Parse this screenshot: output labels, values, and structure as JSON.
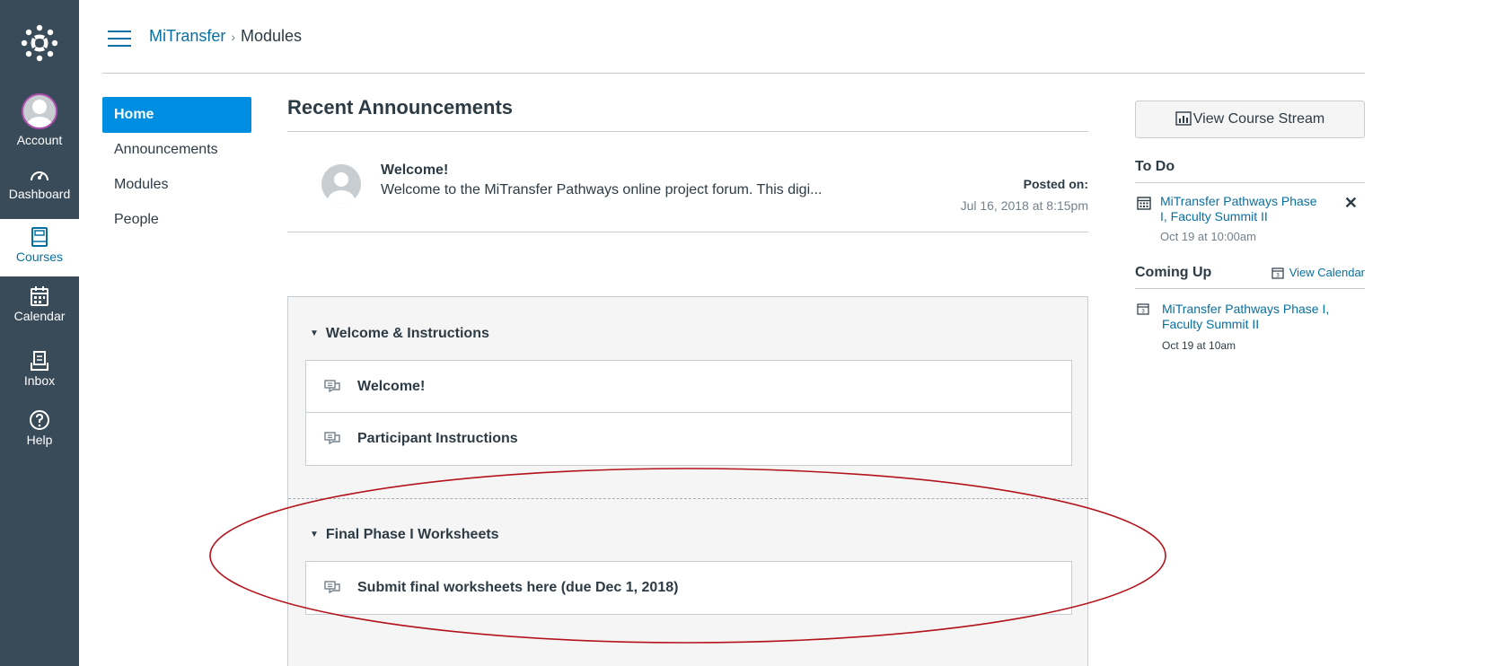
{
  "global_nav": {
    "items": [
      {
        "label": "Account",
        "icon": "user-avatar"
      },
      {
        "label": "Dashboard",
        "icon": "speedometer-icon"
      },
      {
        "label": "Courses",
        "icon": "book-icon",
        "active": true
      },
      {
        "label": "Calendar",
        "icon": "calendar-icon"
      },
      {
        "label": "Inbox",
        "icon": "inbox-icon"
      },
      {
        "label": "Help",
        "icon": "help-icon"
      }
    ]
  },
  "breadcrumb": {
    "course": "MiTransfer",
    "separator": "›",
    "page": "Modules"
  },
  "course_nav": {
    "items": [
      {
        "label": "Home",
        "active": true
      },
      {
        "label": "Announcements"
      },
      {
        "label": "Modules"
      },
      {
        "label": "People"
      }
    ]
  },
  "announcements": {
    "title": "Recent Announcements",
    "items": [
      {
        "title": "Welcome!",
        "preview": "Welcome to the MiTransfer Pathways online project forum. This digi...",
        "posted_label": "Posted on:",
        "posted_date": "Jul 16, 2018 at 8:15pm"
      }
    ]
  },
  "modules": [
    {
      "title": "Welcome & Instructions",
      "items": [
        {
          "label": "Welcome!",
          "icon": "discussion-icon"
        },
        {
          "label": "Participant Instructions",
          "icon": "discussion-icon"
        }
      ]
    },
    {
      "title": "Final Phase I Worksheets",
      "items": [
        {
          "label": "Submit final worksheets here (due Dec 1, 2018)",
          "icon": "discussion-icon"
        }
      ]
    }
  ],
  "sidebar": {
    "stream_button": "View Course Stream",
    "todo": {
      "title": "To Do",
      "items": [
        {
          "title": "MiTransfer Pathways Phase I, Faculty Summit II",
          "date": "Oct 19 at 10:00am",
          "dismiss": "✕"
        }
      ]
    },
    "coming_up": {
      "title": "Coming Up",
      "view_calendar": "View Calendar",
      "items": [
        {
          "title": "MiTransfer Pathways Phase I, Faculty Summit II",
          "date": "Oct 19 at 10am"
        }
      ]
    }
  },
  "colors": {
    "nav_bg": "#394b58",
    "link": "#0770a3",
    "active_nav": "#008ee2",
    "annotation": "#b3131b"
  }
}
